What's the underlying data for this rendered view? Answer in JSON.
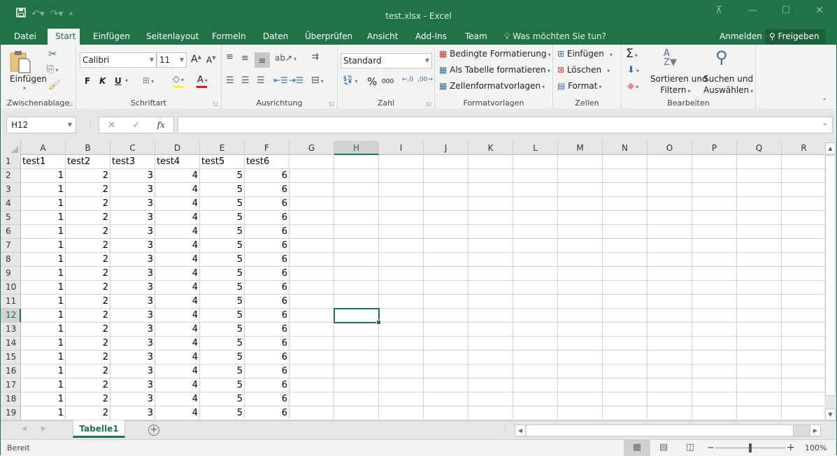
{
  "window": {
    "title": "test.xlsx - Excel",
    "controls": [
      "ribbon-display-options",
      "minimize",
      "maximize",
      "close"
    ]
  },
  "quick_access": {
    "save_icon": "save-icon",
    "undo_icon": "undo-icon",
    "redo_icon": "redo-icon",
    "customize_icon": "customize-qat-icon"
  },
  "tabs": [
    {
      "label": "Datei",
      "active": false
    },
    {
      "label": "Start",
      "active": true
    },
    {
      "label": "Einfügen",
      "active": false
    },
    {
      "label": "Seitenlayout",
      "active": false
    },
    {
      "label": "Formeln",
      "active": false
    },
    {
      "label": "Daten",
      "active": false
    },
    {
      "label": "Überprüfen",
      "active": false
    },
    {
      "label": "Ansicht",
      "active": false
    },
    {
      "label": "Add-Ins",
      "active": false
    },
    {
      "label": "Team",
      "active": false
    }
  ],
  "tell_me": "Was möchten Sie tun?",
  "account": {
    "signin": "Anmelden",
    "share": "Freigeben"
  },
  "ribbon": {
    "clipboard": {
      "label": "Zwischenablage",
      "paste": "Einfügen"
    },
    "font": {
      "label": "Schriftart",
      "font_name": "Calibri",
      "font_size": "11",
      "bold": "F",
      "italic": "K",
      "underline": "U",
      "fill_color": "#ffff00",
      "font_color": "#e81123"
    },
    "alignment": {
      "label": "Ausrichtung"
    },
    "number": {
      "label": "Zahl",
      "format": "Standard",
      "percent": "%",
      "thousands": "000"
    },
    "styles": {
      "label": "Formatvorlagen",
      "conditional": "Bedingte Formatierung",
      "as_table": "Als Tabelle formatieren",
      "cell_styles": "Zellenformatvorlagen"
    },
    "cells": {
      "label": "Zellen",
      "insert": "Einfügen",
      "delete": "Löschen",
      "format": "Format"
    },
    "editing": {
      "label": "Bearbeiten",
      "sort_line1": "Sortieren und",
      "sort_line2": "Filtern",
      "find_line1": "Suchen und",
      "find_line2": "Auswählen"
    }
  },
  "formula_bar": {
    "name_box": "H12",
    "fx": "fx",
    "value": ""
  },
  "columns": [
    "A",
    "B",
    "C",
    "D",
    "E",
    "F",
    "G",
    "H",
    "I",
    "J",
    "K",
    "L",
    "M",
    "N",
    "O",
    "P",
    "Q",
    "R"
  ],
  "selected_column": "H",
  "selected_row": 12,
  "header_row": [
    "test1",
    "test2",
    "test3",
    "test4",
    "test5",
    "test6"
  ],
  "data_row_values": [
    1,
    2,
    3,
    4,
    5,
    6
  ],
  "row_numbers": [
    1,
    2,
    3,
    4,
    5,
    6,
    7,
    8,
    9,
    10,
    11,
    12,
    13,
    14,
    15,
    16,
    17,
    18,
    19
  ],
  "sheets": [
    {
      "name": "Tabelle1",
      "active": true
    }
  ],
  "status": {
    "ready": "Bereit",
    "zoom": "100%",
    "zoom_level": 1.0
  }
}
